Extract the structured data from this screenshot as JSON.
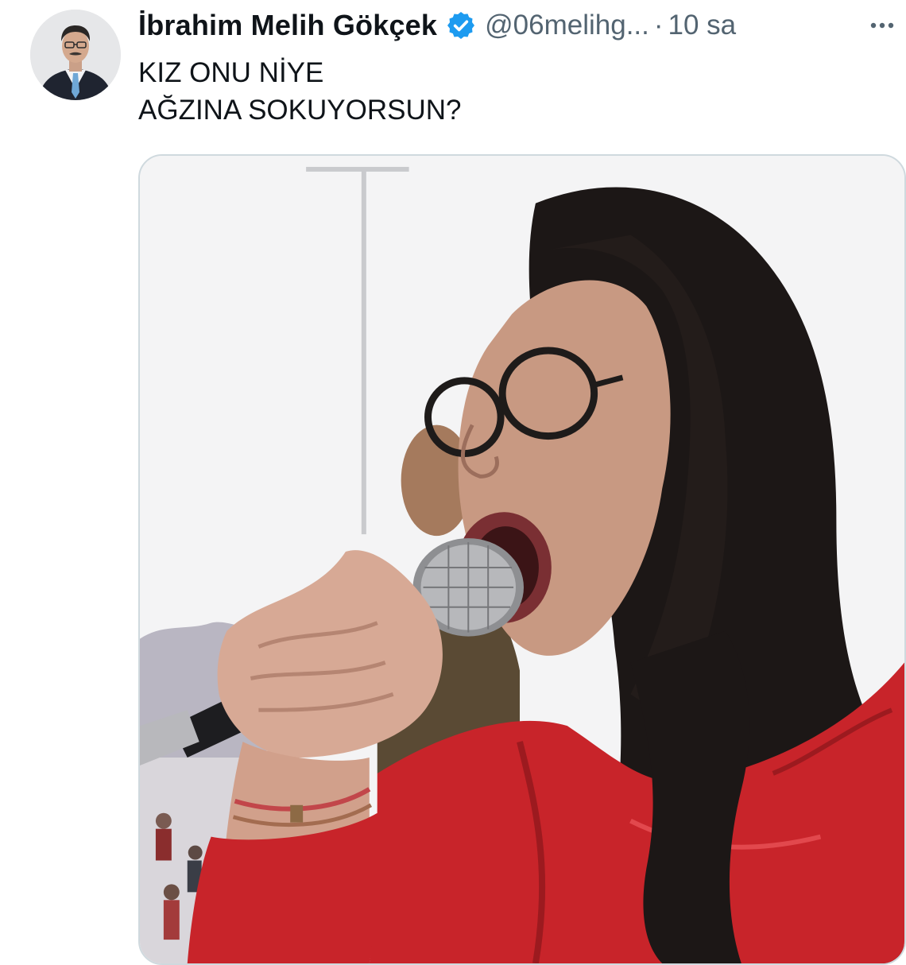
{
  "tweet": {
    "author_name": "İbrahim Melih Gökçek",
    "handle": "@06melihg...",
    "separator": "·",
    "time": "10 sa",
    "text_lines": [
      "KIZ ONU NİYE",
      "AĞZINA SOKUYORSUN?"
    ]
  },
  "icons": {
    "verified": "verified-badge-icon",
    "more": "more-options-icon"
  },
  "colors": {
    "text_primary": "#0f1419",
    "text_secondary": "#536471",
    "verified_blue": "#1d9bf0",
    "media_border": "#cfd9de",
    "jacket_red": "#c8242a"
  }
}
